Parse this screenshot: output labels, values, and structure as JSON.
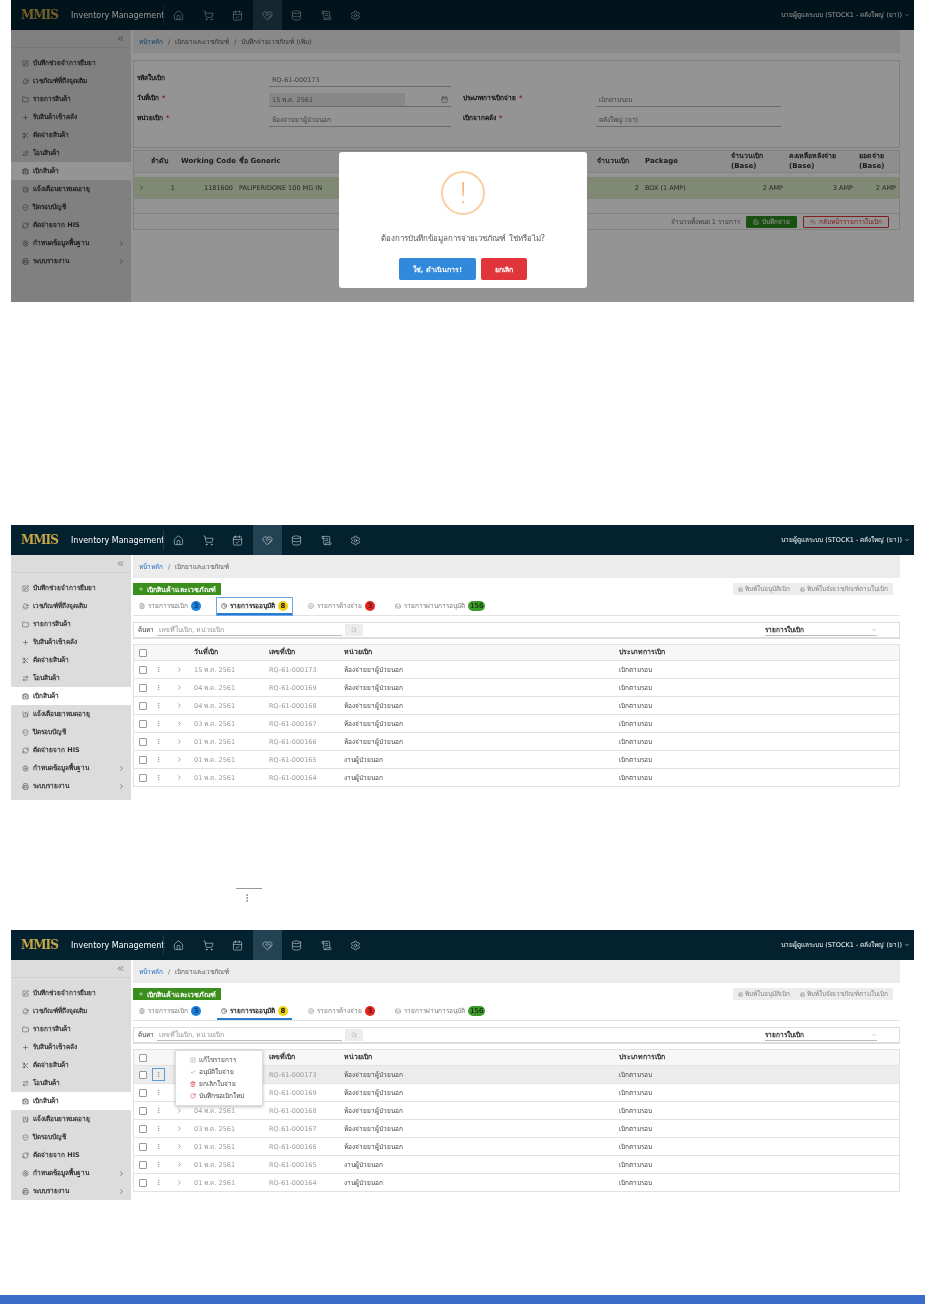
{
  "screens": [
    {
      "kind": "form",
      "header": {
        "logo": "MMIS",
        "title": "Inventory Management",
        "nav": [
          {
            "selected": false
          },
          {
            "selected": false
          },
          {
            "selected": false
          },
          {
            "selected": true
          },
          {
            "selected": false
          },
          {
            "selected": false
          },
          {
            "selected": false
          }
        ],
        "user": "นายผู้ดูแลระบบ (STOCK1 - คลังใหญ่ (ยา))"
      },
      "sidebar": [
        {
          "label": "บันทึกช่วยจำการยืมยา",
          "selected": false,
          "expandable": false
        },
        {
          "label": "เวชภัณฑ์ที่ถึงจุดเติม",
          "selected": false,
          "expandable": false
        },
        {
          "label": "รายการสินค้า",
          "selected": false,
          "expandable": false
        },
        {
          "label": "รับสินค้าเข้าคลัง",
          "selected": false,
          "expandable": false
        },
        {
          "label": "ตัดจ่ายสินค้า",
          "selected": false,
          "expandable": false
        },
        {
          "label": "โอนสินค้า",
          "selected": false,
          "expandable": false
        },
        {
          "label": "เบิกสินค้า",
          "selected": true,
          "expandable": false
        },
        {
          "label": "แจ้งเตือนยาหมดอายุ",
          "selected": false,
          "expandable": false
        },
        {
          "label": "ปิดรอบบัญชี",
          "selected": false,
          "expandable": false
        },
        {
          "label": "ตัดจ่ายจาก HIS",
          "selected": false,
          "expandable": false
        },
        {
          "label": "กำหนดข้อมูลพื้นฐาน",
          "selected": false,
          "expandable": true
        },
        {
          "label": "ระบบรายงาน",
          "selected": false,
          "expandable": true
        }
      ],
      "breadcrumb": {
        "separator": "/",
        "items": [
          {
            "label": "หน้าหลัก",
            "link": true
          },
          {
            "label": "เบิกยาและเวชภัณฑ์",
            "link": false
          },
          {
            "label": "บันทึกจ่ายเวชภัณฑ์ (เพิ่ม)",
            "link": false
          }
        ]
      },
      "form": {
        "rows": [
          [
            {
              "label": "รหัสใบเบิก",
              "value": "RQ-61-000173",
              "kind": "text"
            }
          ],
          [
            {
              "label": "วันที่เบิก",
              "mark": "*",
              "value": "15 พ.ค. 2561",
              "kind": "date"
            },
            {
              "label": "ประเภทการเบิกจ่าย",
              "mark": "*",
              "value": "เบิกตามรอบ",
              "kind": "text"
            }
          ],
          [
            {
              "label": "หน่วยเบิก",
              "mark": "*",
              "value": "ห้องจ่ายยาผู้ป่วยนอก",
              "kind": "text"
            },
            {
              "label": "เบิกจากคลัง",
              "mark": "*",
              "value": "คลังใหญ่ (ยา)",
              "kind": "text"
            }
          ]
        ]
      },
      "table": {
        "columns": [
          "ลำดับ",
          "Working Code",
          "ชื่อ Generic",
          "จำนวนเบิก",
          "Package",
          "จำนวนเบิก (Base)",
          "คงเหลือหลังจ่าย (Base)",
          "ยอดจ่าย (Base)"
        ],
        "rows": [
          {
            "selected": true,
            "cells": [
              "1",
              "1181600",
              "PALIPERIDONE 100 MG IN",
              "2",
              "BOX (1 AMP)",
              "2 AMP",
              "3 AMP",
              "2 AMP"
            ]
          }
        ],
        "count": "จำนวนทั้งหมด 1 รายการ",
        "buttons": [
          {
            "label": "บันทึกจ่าย",
            "kind": "primary"
          },
          {
            "label": "กลับหน้ารายการใบเบิก",
            "kind": "danger"
          }
        ]
      },
      "dialog": {
        "icon": "!",
        "message": "ต้องการบันทึกข้อมูลการจ่ายเวชภัณฑ์ ใช่หรือไม่?",
        "buttons": [
          {
            "label": "ใช่, ดำเนินการ!",
            "kind": "confirm"
          },
          {
            "label": "ยกเลิก",
            "kind": "cancel"
          }
        ]
      }
    },
    {
      "kind": "list",
      "header": {
        "logo": "MMIS",
        "title": "Inventory Management",
        "nav": [
          {
            "selected": false
          },
          {
            "selected": false
          },
          {
            "selected": false
          },
          {
            "selected": true
          },
          {
            "selected": false
          },
          {
            "selected": false
          },
          {
            "selected": false
          }
        ],
        "user": "นายผู้ดูแลระบบ (STOCK1 - คลังใหญ่ (ยา))"
      },
      "sidebar": [
        {
          "label": "บันทึกช่วยจำการยืมยา",
          "selected": false,
          "expandable": false
        },
        {
          "label": "เวชภัณฑ์ที่ถึงจุดเติม",
          "selected": false,
          "expandable": false
        },
        {
          "label": "รายการสินค้า",
          "selected": false,
          "expandable": false
        },
        {
          "label": "รับสินค้าเข้าคลัง",
          "selected": false,
          "expandable": false
        },
        {
          "label": "ตัดจ่ายสินค้า",
          "selected": false,
          "expandable": false
        },
        {
          "label": "โอนสินค้า",
          "selected": false,
          "expandable": false
        },
        {
          "label": "เบิกสินค้า",
          "selected": true,
          "expandable": false
        },
        {
          "label": "แจ้งเตือนยาหมดอายุ",
          "selected": false,
          "expandable": false
        },
        {
          "label": "ปิดรอบบัญชี",
          "selected": false,
          "expandable": false
        },
        {
          "label": "ตัดจ่ายจาก HIS",
          "selected": false,
          "expandable": false
        },
        {
          "label": "กำหนดข้อมูลพื้นฐาน",
          "selected": false,
          "expandable": true
        },
        {
          "label": "ระบบรายงาน",
          "selected": false,
          "expandable": true
        }
      ],
      "breadcrumb": {
        "separator": "/",
        "items": [
          {
            "label": "หน้าหลัก",
            "link": true
          },
          {
            "label": "เบิกยาและเวชภัณฑ์",
            "link": false
          }
        ]
      },
      "add_button": "เบิกสินค้าและเวชภัณฑ์",
      "actions": [
        {
          "label": "พิมพ์ใบอนุมัติเบิก",
          "disabled": true
        },
        {
          "label": "พิมพ์ใบจัดเวชภัณฑ์ตามใบเบิก",
          "disabled": true
        }
      ],
      "tabs": [
        {
          "label": "รายการขอเบิก",
          "badge": "3",
          "color": "#1a7ee0",
          "selected": false,
          "focused": false
        },
        {
          "label": "รายการรออนุมัติ",
          "badge": "8",
          "color": "#f2d20c",
          "selected": true,
          "focused": true
        },
        {
          "label": "รายการค้างจ่าย",
          "badge": "3",
          "color": "#e0261f",
          "selected": false,
          "focused": false
        },
        {
          "label": "รายการผ่านการอนุมัติ",
          "badge": "156",
          "color": "#3c9a2a",
          "selected": false,
          "focused": false
        }
      ],
      "search": {
        "label": "ค้นหา",
        "placeholder": "เลขที่ใบเบิก, หน่วยเบิก"
      },
      "filter": {
        "value": "รายการใบเบิก"
      },
      "table": {
        "all_checked": false,
        "columns": [
          {
            "kind": "date",
            "label": "วันที่เบิก"
          },
          {
            "kind": "number",
            "label": "เลขที่เบิก"
          },
          {
            "kind": "unit",
            "label": "หน่วยเบิก"
          },
          {
            "kind": "type",
            "label": "ประเภทการเบิก"
          }
        ],
        "rows": [
          {
            "checked": false,
            "selected": false,
            "date": "15 พ.ค. 2561",
            "number": "RQ-61-000173",
            "unit": "ห้องจ่ายยาผู้ป่วยนอก",
            "type": "เบิกตามรอบ"
          },
          {
            "checked": false,
            "selected": false,
            "date": "04 พ.ค. 2561",
            "number": "RQ-61-000169",
            "unit": "ห้องจ่ายยาผู้ป่วยนอก",
            "type": "เบิกตามรอบ"
          },
          {
            "checked": false,
            "selected": false,
            "date": "04 พ.ค. 2561",
            "number": "RQ-61-000168",
            "unit": "ห้องจ่ายยาผู้ป่วยนอก",
            "type": "เบิกตามรอบ"
          },
          {
            "checked": false,
            "selected": false,
            "date": "03 พ.ค. 2561",
            "number": "RQ-61-000167",
            "unit": "ห้องจ่ายยาผู้ป่วยนอก",
            "type": "เบิกตามรอบ"
          },
          {
            "checked": false,
            "selected": false,
            "date": "01 พ.ค. 2561",
            "number": "RQ-61-000166",
            "unit": "ห้องจ่ายยาผู้ป่วยนอก",
            "type": "เบิกตามรอบ"
          },
          {
            "checked": false,
            "selected": false,
            "date": "01 พ.ค. 2561",
            "number": "RQ-61-000165",
            "unit": "งานผู้ป่วยนอก",
            "type": "เบิกตามรอบ"
          },
          {
            "checked": false,
            "selected": false,
            "date": "01 พ.ค. 2561",
            "number": "RQ-61-000164",
            "unit": "งานผู้ป่วยนอก",
            "type": "เบิกตามรอบ"
          }
        ]
      }
    },
    {
      "kind": "list",
      "header": {
        "logo": "MMIS",
        "title": "Inventory Management",
        "nav": [
          {
            "selected": false
          },
          {
            "selected": false
          },
          {
            "selected": false
          },
          {
            "selected": true
          },
          {
            "selected": false
          },
          {
            "selected": false
          },
          {
            "selected": false
          }
        ],
        "user": "นายผู้ดูแลระบบ (STOCK1 - คลังใหญ่ (ยา))"
      },
      "sidebar": [
        {
          "label": "บันทึกช่วยจำการยืมยา",
          "selected": false,
          "expandable": false
        },
        {
          "label": "เวชภัณฑ์ที่ถึงจุดเติม",
          "selected": false,
          "expandable": false
        },
        {
          "label": "รายการสินค้า",
          "selected": false,
          "expandable": false
        },
        {
          "label": "รับสินค้าเข้าคลัง",
          "selected": false,
          "expandable": false
        },
        {
          "label": "ตัดจ่ายสินค้า",
          "selected": false,
          "expandable": false
        },
        {
          "label": "โอนสินค้า",
          "selected": false,
          "expandable": false
        },
        {
          "label": "เบิกสินค้า",
          "selected": true,
          "expandable": false
        },
        {
          "label": "แจ้งเตือนยาหมดอายุ",
          "selected": false,
          "expandable": false
        },
        {
          "label": "ปิดรอบบัญชี",
          "selected": false,
          "expandable": false
        },
        {
          "label": "ตัดจ่ายจาก HIS",
          "selected": false,
          "expandable": false
        },
        {
          "label": "กำหนดข้อมูลพื้นฐาน",
          "selected": false,
          "expandable": true
        },
        {
          "label": "ระบบรายงาน",
          "selected": false,
          "expandable": true
        }
      ],
      "breadcrumb": {
        "separator": "/",
        "items": [
          {
            "label": "หน้าหลัก",
            "link": true
          },
          {
            "label": "เบิกยาและเวชภัณฑ์",
            "link": false
          }
        ]
      },
      "add_button": "เบิกสินค้าและเวชภัณฑ์",
      "actions": [
        {
          "label": "พิมพ์ใบอนุมัติเบิก",
          "disabled": true
        },
        {
          "label": "พิมพ์ใบจัดเวชภัณฑ์ตามใบเบิก",
          "disabled": true
        }
      ],
      "tabs": [
        {
          "label": "รายการขอเบิก",
          "badge": "3",
          "color": "#1a7ee0",
          "selected": false,
          "focused": false
        },
        {
          "label": "รายการรออนุมัติ",
          "badge": "8",
          "color": "#f2d20c",
          "selected": true,
          "focused": false
        },
        {
          "label": "รายการค้างจ่าย",
          "badge": "3",
          "color": "#e0261f",
          "selected": false,
          "focused": false
        },
        {
          "label": "รายการผ่านการอนุมัติ",
          "badge": "156",
          "color": "#3c9a2a",
          "selected": false,
          "focused": false
        }
      ],
      "search": {
        "label": "ค้นหา",
        "placeholder": "เลขที่ใบเบิก, หน่วยเบิก"
      },
      "filter": {
        "value": "รายการใบเบิก"
      },
      "table": {
        "all_checked": false,
        "columns": [
          {
            "kind": "number",
            "label": "เลขที่เบิก"
          },
          {
            "kind": "unit",
            "label": "หน่วยเบิก"
          },
          {
            "kind": "type",
            "label": "ประเภทการเบิก"
          }
        ],
        "rows": [
          {
            "checked": false,
            "selected": true,
            "number": "RQ-61-000173",
            "unit": "ห้องจ่ายยาผู้ป่วยนอก",
            "type": "เบิกตามรอบ"
          },
          {
            "checked": false,
            "selected": false,
            "number": "RQ-61-000169",
            "unit": "ห้องจ่ายยาผู้ป่วยนอก",
            "type": "เบิกตามรอบ"
          },
          {
            "checked": false,
            "selected": false,
            "date": "04 พ.ค. 2561",
            "number": "RQ-61-000168",
            "unit": "ห้องจ่ายยาผู้ป่วยนอก",
            "type": "เบิกตามรอบ"
          },
          {
            "checked": false,
            "selected": false,
            "date": "03 พ.ค. 2561",
            "number": "RQ-61-000167",
            "unit": "ห้องจ่ายยาผู้ป่วยนอก",
            "type": "เบิกตามรอบ"
          },
          {
            "checked": false,
            "selected": false,
            "date": "01 พ.ค. 2561",
            "number": "RQ-61-000166",
            "unit": "ห้องจ่ายยาผู้ป่วยนอก",
            "type": "เบิกตามรอบ"
          },
          {
            "checked": false,
            "selected": false,
            "date": "01 พ.ค. 2561",
            "number": "RQ-61-000165",
            "unit": "งานผู้ป่วยนอก",
            "type": "เบิกตามรอบ"
          },
          {
            "checked": false,
            "selected": false,
            "date": "01 พ.ค. 2561",
            "number": "RQ-61-000164",
            "unit": "งานผู้ป่วยนอก",
            "type": "เบิกตามรอบ"
          }
        ]
      },
      "menu": [
        {
          "label": "แก้ไขรายการ",
          "kind": "edit"
        },
        {
          "label": "อนุมัติใบจ่าย",
          "kind": "approve"
        },
        {
          "label": "ยกเลิกใบจ่าย",
          "kind": "cancel"
        },
        {
          "label": "บันทึกขอเบิกใหม่",
          "kind": "renew"
        }
      ]
    }
  ]
}
